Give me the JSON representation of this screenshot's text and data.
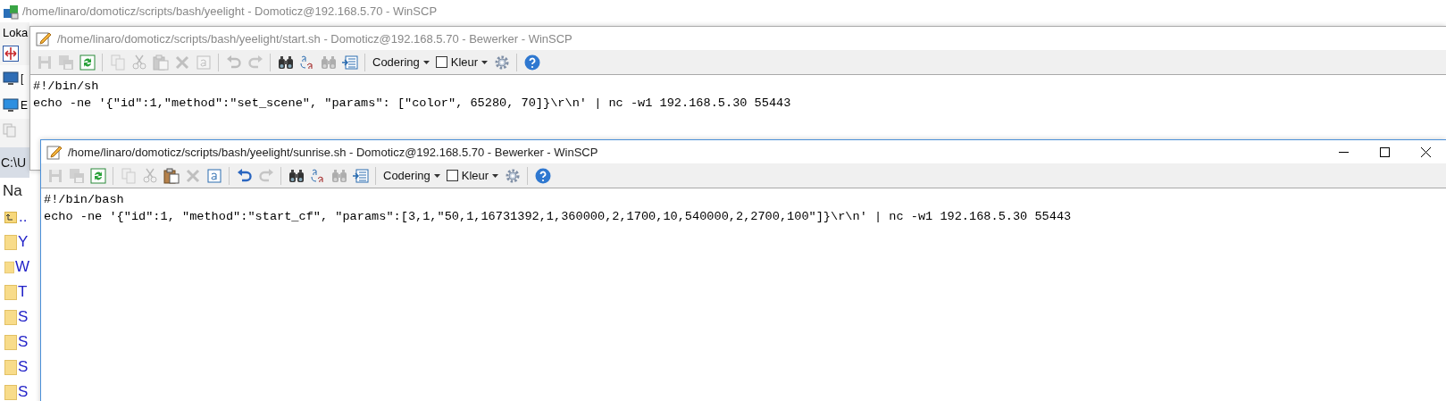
{
  "main_window": {
    "title": "/home/linaro/domoticz/scripts/bash/yeelight - Domoticz@192.168.5.70 - WinSCP",
    "active": false,
    "sidebar": [
      {
        "kind": "menu",
        "label": "Loka"
      },
      {
        "kind": "tool"
      },
      {
        "kind": "computer",
        "label": "["
      },
      {
        "kind": "screen",
        "label": "E"
      },
      {
        "kind": "copy"
      },
      {
        "kind": "path",
        "label": "C:\\U"
      },
      {
        "kind": "header",
        "label": "Na"
      },
      {
        "kind": "parent",
        "label": ".."
      },
      {
        "kind": "folder",
        "label": "Y"
      },
      {
        "kind": "folder",
        "label": "W"
      },
      {
        "kind": "folder",
        "label": "T"
      },
      {
        "kind": "folder",
        "label": "S"
      },
      {
        "kind": "folder",
        "label": "S"
      },
      {
        "kind": "folder",
        "label": "S"
      },
      {
        "kind": "folder",
        "label": "S"
      }
    ]
  },
  "editors": [
    {
      "title": "/home/linaro/domoticz/scripts/bash/yeelight/start.sh - Domoticz@192.168.5.70 - Bewerker - WinSCP",
      "active": false,
      "window_buttons": false,
      "toolbar": [
        {
          "kind": "save",
          "disabled": true
        },
        {
          "kind": "saveall",
          "disabled": true
        },
        {
          "kind": "reload",
          "disabled": false
        },
        {
          "kind": "separator"
        },
        {
          "kind": "copy",
          "disabled": true
        },
        {
          "kind": "cut",
          "disabled": true
        },
        {
          "kind": "paste",
          "disabled": true
        },
        {
          "kind": "delete",
          "disabled": true
        },
        {
          "kind": "selectall",
          "disabled": true
        },
        {
          "kind": "separator"
        },
        {
          "kind": "undo",
          "disabled": true
        },
        {
          "kind": "redo",
          "disabled": true
        },
        {
          "kind": "separator"
        },
        {
          "kind": "find",
          "disabled": false
        },
        {
          "kind": "replace",
          "disabled": false
        },
        {
          "kind": "findnext",
          "disabled": true
        },
        {
          "kind": "goto",
          "disabled": false
        },
        {
          "kind": "separator"
        },
        {
          "kind": "dropdown",
          "label": "Codering"
        },
        {
          "kind": "checkdrop",
          "label": "Kleur",
          "checked": false
        },
        {
          "kind": "settings",
          "disabled": false
        },
        {
          "kind": "separator"
        },
        {
          "kind": "help",
          "disabled": false
        }
      ],
      "lines": [
        "#!/bin/sh",
        "echo -ne '{\"id\":1,\"method\":\"set_scene\", \"params\": [\"color\", 65280, 70]}\\r\\n' | nc -w1 192.168.5.30 55443"
      ]
    },
    {
      "title": "/home/linaro/domoticz/scripts/bash/yeelight/sunrise.sh - Domoticz@192.168.5.70 - Bewerker - WinSCP",
      "active": true,
      "window_buttons": true,
      "toolbar": [
        {
          "kind": "save",
          "disabled": true
        },
        {
          "kind": "saveall",
          "disabled": true
        },
        {
          "kind": "reload",
          "disabled": false
        },
        {
          "kind": "separator"
        },
        {
          "kind": "copy",
          "disabled": true
        },
        {
          "kind": "cut",
          "disabled": true
        },
        {
          "kind": "paste",
          "disabled": false
        },
        {
          "kind": "delete",
          "disabled": true
        },
        {
          "kind": "selectall",
          "disabled": false
        },
        {
          "kind": "separator"
        },
        {
          "kind": "undo",
          "disabled": false
        },
        {
          "kind": "redo",
          "disabled": true
        },
        {
          "kind": "separator"
        },
        {
          "kind": "find",
          "disabled": false
        },
        {
          "kind": "replace",
          "disabled": false
        },
        {
          "kind": "findnext",
          "disabled": true
        },
        {
          "kind": "goto",
          "disabled": false
        },
        {
          "kind": "separator"
        },
        {
          "kind": "dropdown",
          "label": "Codering"
        },
        {
          "kind": "checkdrop",
          "label": "Kleur",
          "checked": false
        },
        {
          "kind": "settings",
          "disabled": false
        },
        {
          "kind": "separator"
        },
        {
          "kind": "help",
          "disabled": false
        }
      ],
      "lines": [
        "#!/bin/bash",
        "echo -ne '{\"id\":1, \"method\":\"start_cf\", \"params\":[3,1,\"50,1,16731392,1,360000,2,1700,10,540000,2,2700,100\"]}\\r\\n' | nc -w1 192.168.5.30 55443"
      ]
    }
  ]
}
